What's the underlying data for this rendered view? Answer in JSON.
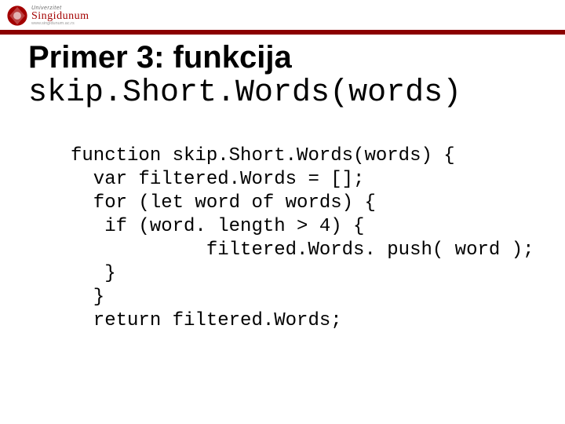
{
  "logo": {
    "uni": "Univerzitet",
    "name": "Singidunum",
    "url": "www.singidunum.ac.rs"
  },
  "title": {
    "line1": "Primer 3: funkcija",
    "line2": "skip.Short.Words(words)"
  },
  "code": {
    "l1": "function skip.Short.Words(words) {",
    "l2": "  var filtered.Words = [];",
    "l3": "  for (let word of words) {",
    "l4": "   if (word. length > 4) {",
    "l5": "            filtered.Words. push( word );",
    "l6": "   }",
    "l7": "  }",
    "l8": "  return filtered.Words;"
  }
}
